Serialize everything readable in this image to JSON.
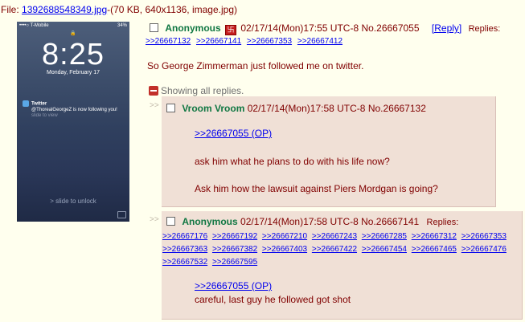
{
  "file": {
    "label": "File:",
    "filename": "1392688548349.jpg",
    "meta": "-(70 KB, 640x1136, image.jpg)"
  },
  "thumbnail": {
    "carrier": "••••○ T-Mobile ",
    "battery": "34% ",
    "time": "8:25",
    "date": "Monday, February 17",
    "notif_app": "Twitter",
    "notif_body": "@ThorealGeorgeZ is now following you!",
    "notif_sub": "slide to view",
    "slide_text": "slide to unlock"
  },
  "op": {
    "name": "Anonymous",
    "datetime": "02/17/14(Mon)17:55 UTC-8",
    "number": "No.26667055",
    "reply_label": "[Reply]",
    "replies_label": "Replies:",
    "replies": [
      ">>26667132",
      ">>26667141",
      ">>26667353",
      ">>26667412"
    ],
    "comment": "So George Zimmerman just followed me on twitter."
  },
  "showing_label": "Showing all replies.",
  "posts": [
    {
      "arrow": ">>",
      "name": "Vroom Vroom",
      "datetime": "02/17/14(Mon)17:58 UTC-8",
      "number": "No.26667132",
      "quote": ">>26667055 (OP)",
      "line1": "ask him what he plans to do with his life now?",
      "line2": "Ask him how the lawsuit against Piers Mordgan is going?"
    },
    {
      "arrow": ">>",
      "name": "Anonymous",
      "datetime": "02/17/14(Mon)17:58 UTC-8",
      "number": "No.26667141",
      "replies_label": "Replies:",
      "replies": [
        ">>26667176",
        ">>26667192",
        ">>26667210",
        ">>26667243",
        ">>26667285",
        ">>26667312",
        ">>26667353",
        ">>26667363",
        ">>26667382",
        ">>26667403",
        ">>26667422",
        ">>26667454",
        ">>26667465",
        ">>26667476",
        ">>26667532",
        ">>26667595"
      ],
      "quote": ">>26667055 (OP)",
      "line1": "careful, last guy he followed got shot"
    }
  ]
}
